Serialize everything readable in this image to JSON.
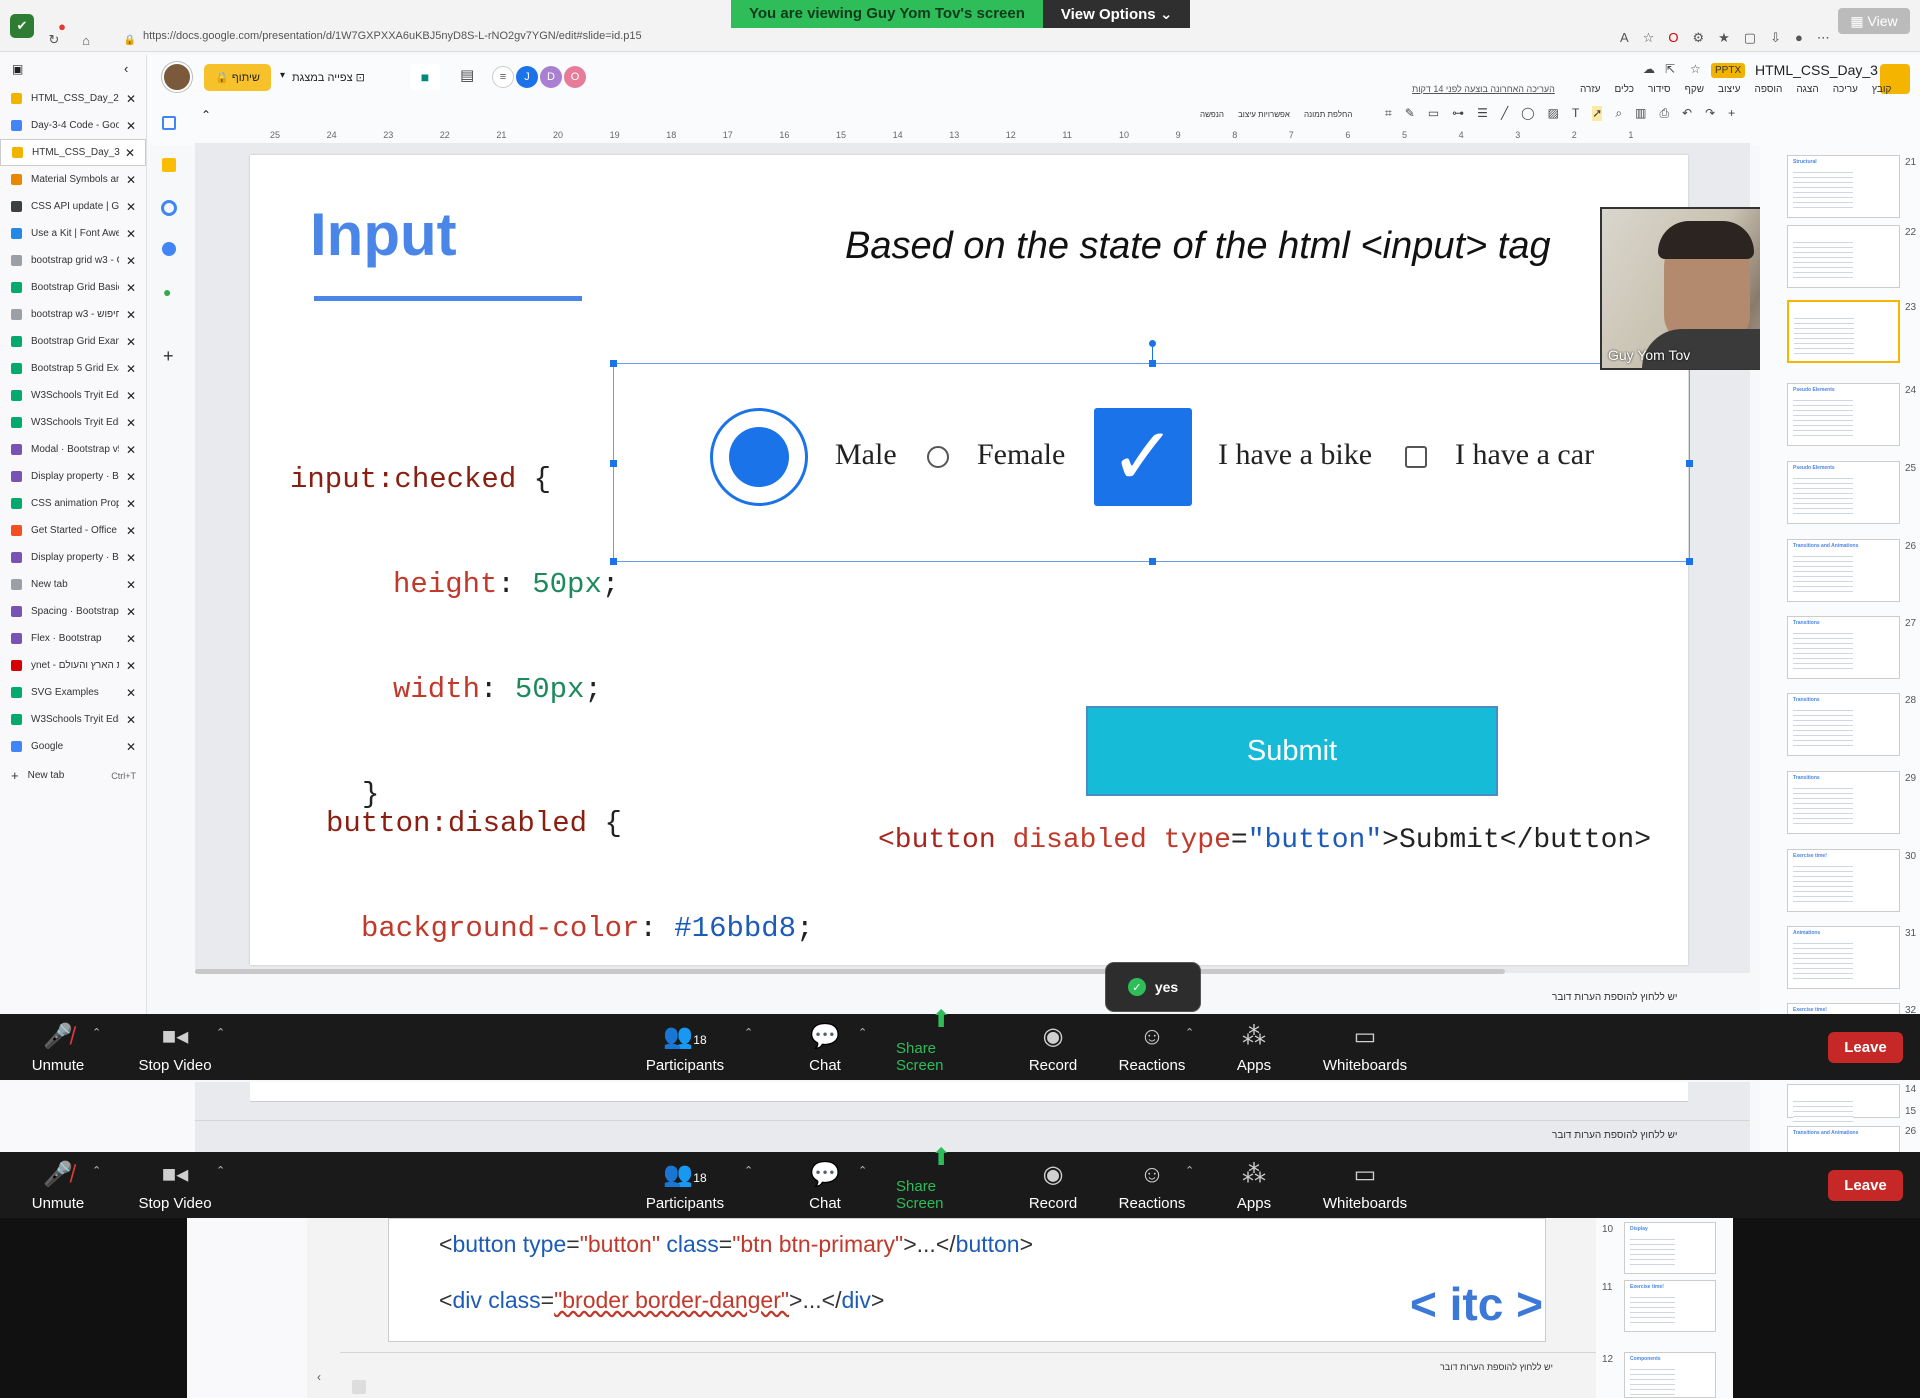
{
  "banner": {
    "viewing_text": "You are viewing Guy Yom Tov's screen",
    "view_options_label": "View Options"
  },
  "browser": {
    "url": "https://docs.google.com/presentation/d/1W7GXPXXA6uKBJ5nyD8S-L-rNO2gv7YGN/edit#slide=id.p15",
    "view_label": "View"
  },
  "tabs": [
    {
      "title": "HTML_CSS_Day_2.ppt",
      "color": "#f0b400",
      "active": false
    },
    {
      "title": "Day-3-4 Code - Goog",
      "color": "#4285f4",
      "active": false
    },
    {
      "title": "HTML_CSS_Day_3.ppt",
      "color": "#f0b400",
      "active": true
    },
    {
      "title": "Material Symbols and",
      "color": "#ea8600",
      "active": false
    },
    {
      "title": "CSS API update | Goo",
      "color": "#3c4043",
      "active": false
    },
    {
      "title": "Use a Kit | Font Aweso",
      "color": "#228ae6",
      "active": false
    },
    {
      "title": "bootstrap grid w3 - G",
      "color": "#9aa0a6",
      "active": false
    },
    {
      "title": "Bootstrap Grid Basic",
      "color": "#04aa6d",
      "active": false
    },
    {
      "title": "bootstrap w3 - ג חיפוש",
      "color": "#9aa0a6",
      "active": false
    },
    {
      "title": "Bootstrap Grid Examp",
      "color": "#04aa6d",
      "active": false
    },
    {
      "title": "Bootstrap 5 Grid Exam",
      "color": "#04aa6d",
      "active": false
    },
    {
      "title": "W3Schools Tryit Editor",
      "color": "#04aa6d",
      "active": false
    },
    {
      "title": "W3Schools Tryit Editor",
      "color": "#04aa6d",
      "active": false
    },
    {
      "title": "Modal · Bootstrap v5.2",
      "color": "#7952b3",
      "active": false
    },
    {
      "title": "Display property · Boo",
      "color": "#7952b3",
      "active": false
    },
    {
      "title": "CSS animation Propert",
      "color": "#04aa6d",
      "active": false
    },
    {
      "title": "Get Started - Office UI",
      "color": "#f25022",
      "active": false
    },
    {
      "title": "Display property · Boo",
      "color": "#7952b3",
      "active": false
    },
    {
      "title": "New tab",
      "color": "#9aa0a6",
      "active": false
    },
    {
      "title": "Spacing · Bootstrap",
      "color": "#7952b3",
      "active": false
    },
    {
      "title": "Flex · Bootstrap",
      "color": "#7952b3",
      "active": false
    },
    {
      "title": "ynet - חדשות הארץ והעולם",
      "color": "#d50000",
      "active": false
    },
    {
      "title": "SVG Examples",
      "color": "#04aa6d",
      "active": false
    },
    {
      "title": "W3Schools Tryit Editor",
      "color": "#04aa6d",
      "active": false
    },
    {
      "title": "Google",
      "color": "#4285f4",
      "active": false
    }
  ],
  "new_tab": {
    "label": "New tab",
    "shortcut": "Ctrl+T"
  },
  "slides_app": {
    "doc_title": "HTML_CSS_Day_3",
    "format_badge": "PPTX",
    "share_label": "שיתוף",
    "present_label": "צפייה במצגת",
    "last_edit": "העריכה האחרונה בוצעה לפני 14 דקות",
    "menu": [
      "קובץ",
      "עריכה",
      "הצגה",
      "הוספה",
      "עיצוב",
      "שקף",
      "סידור",
      "כלים",
      "עזרה"
    ],
    "collaborators": [
      {
        "initial": "J",
        "color": "#1a73e8"
      },
      {
        "initial": "D",
        "color": "#a97fd1"
      },
      {
        "initial": "O",
        "color": "#e67c9a"
      }
    ],
    "toolbar_text": [
      "החלפת תמונה",
      "אפשרויות עיצוב",
      "הנפשה"
    ],
    "ruler_labels": [
      "25",
      "24",
      "23",
      "22",
      "21",
      "20",
      "19",
      "18",
      "17",
      "16",
      "15",
      "14",
      "13",
      "12",
      "11",
      "10",
      "9",
      "8",
      "7",
      "6",
      "5",
      "4",
      "3",
      "2",
      "1"
    ]
  },
  "slide": {
    "title": "Input",
    "subtitle": "Based on the state of the html <input> tag",
    "css_checked": {
      "selector": "input:checked",
      "open": "{",
      "height_prop": "height",
      "height_val": "50px",
      "width_prop": "width",
      "width_val": "50px",
      "close": "}"
    },
    "demo": {
      "male_label": "Male",
      "female_label": "Female",
      "bike_label": "I have a bike",
      "car_label": "I have a car"
    },
    "css_disabled": {
      "selector": "button:disabled",
      "open": "{",
      "prop": "background-color",
      "value": "#16bbd8",
      "close": "}"
    },
    "submit_label": "Submit",
    "button_html": {
      "open_tag": "<button",
      "attr_disabled": "disabled",
      "attr_type": "type",
      "eq": "=",
      "type_value": "\"button\"",
      "gt": ">",
      "text": "Submit",
      "close_tag": "</button>"
    }
  },
  "webcam": {
    "name": "Guy Yom Tov"
  },
  "thumbnails": [
    {
      "num": "21",
      "title": "Structural"
    },
    {
      "num": "22",
      "title": ""
    },
    {
      "num": "23",
      "title": ""
    },
    {
      "num": "24",
      "title": "Pseudo Elements"
    },
    {
      "num": "25",
      "title": "Pseudo Elements"
    },
    {
      "num": "26",
      "title": "Transitions and Animations"
    },
    {
      "num": "27",
      "title": "Transitions"
    },
    {
      "num": "28",
      "title": "Transitions"
    },
    {
      "num": "29",
      "title": "Transitions"
    },
    {
      "num": "30",
      "title": "Exercise time!"
    },
    {
      "num": "31",
      "title": "Animations"
    },
    {
      "num": "32",
      "title": "Exercise time!"
    }
  ],
  "notes_hint": "יש ללחוץ להוספת הערות דובר",
  "toast": {
    "text": "yes"
  },
  "zoom": {
    "unmute_label": "Unmute",
    "stop_video_label": "Stop Video",
    "participants_label": "Participants",
    "participants_count": "18",
    "chat_label": "Chat",
    "share_label": "Share Screen",
    "record_label": "Record",
    "reactions_label": "Reactions",
    "apps_label": "Apps",
    "whiteboards_label": "Whiteboards",
    "leave_label": "Leave"
  },
  "lower": {
    "thumb_nums": [
      "14",
      "15",
      "26"
    ],
    "thumb_title": "Transitions and Animations",
    "code1": {
      "lt": "<",
      "tag": "button",
      "a1": "type",
      "eq": "=",
      "v1": "\"button\"",
      "a2": "class",
      "v2": "\"btn btn-primary\"",
      "mid": ">...</",
      "end_tag": "button",
      "gt": ">"
    },
    "code2": {
      "lt": "<",
      "tag": "div",
      "a1": "class",
      "eq": "=",
      "v1": "\"broder border-danger\"",
      "mid": ">...</",
      "end_tag": "div",
      "gt": ">"
    },
    "logo": "< itc >",
    "inner_thumb_nums": [
      "10",
      "11",
      "12"
    ],
    "inner_thumb_titles": [
      "Display",
      "Exercise time!",
      "Components"
    ]
  }
}
